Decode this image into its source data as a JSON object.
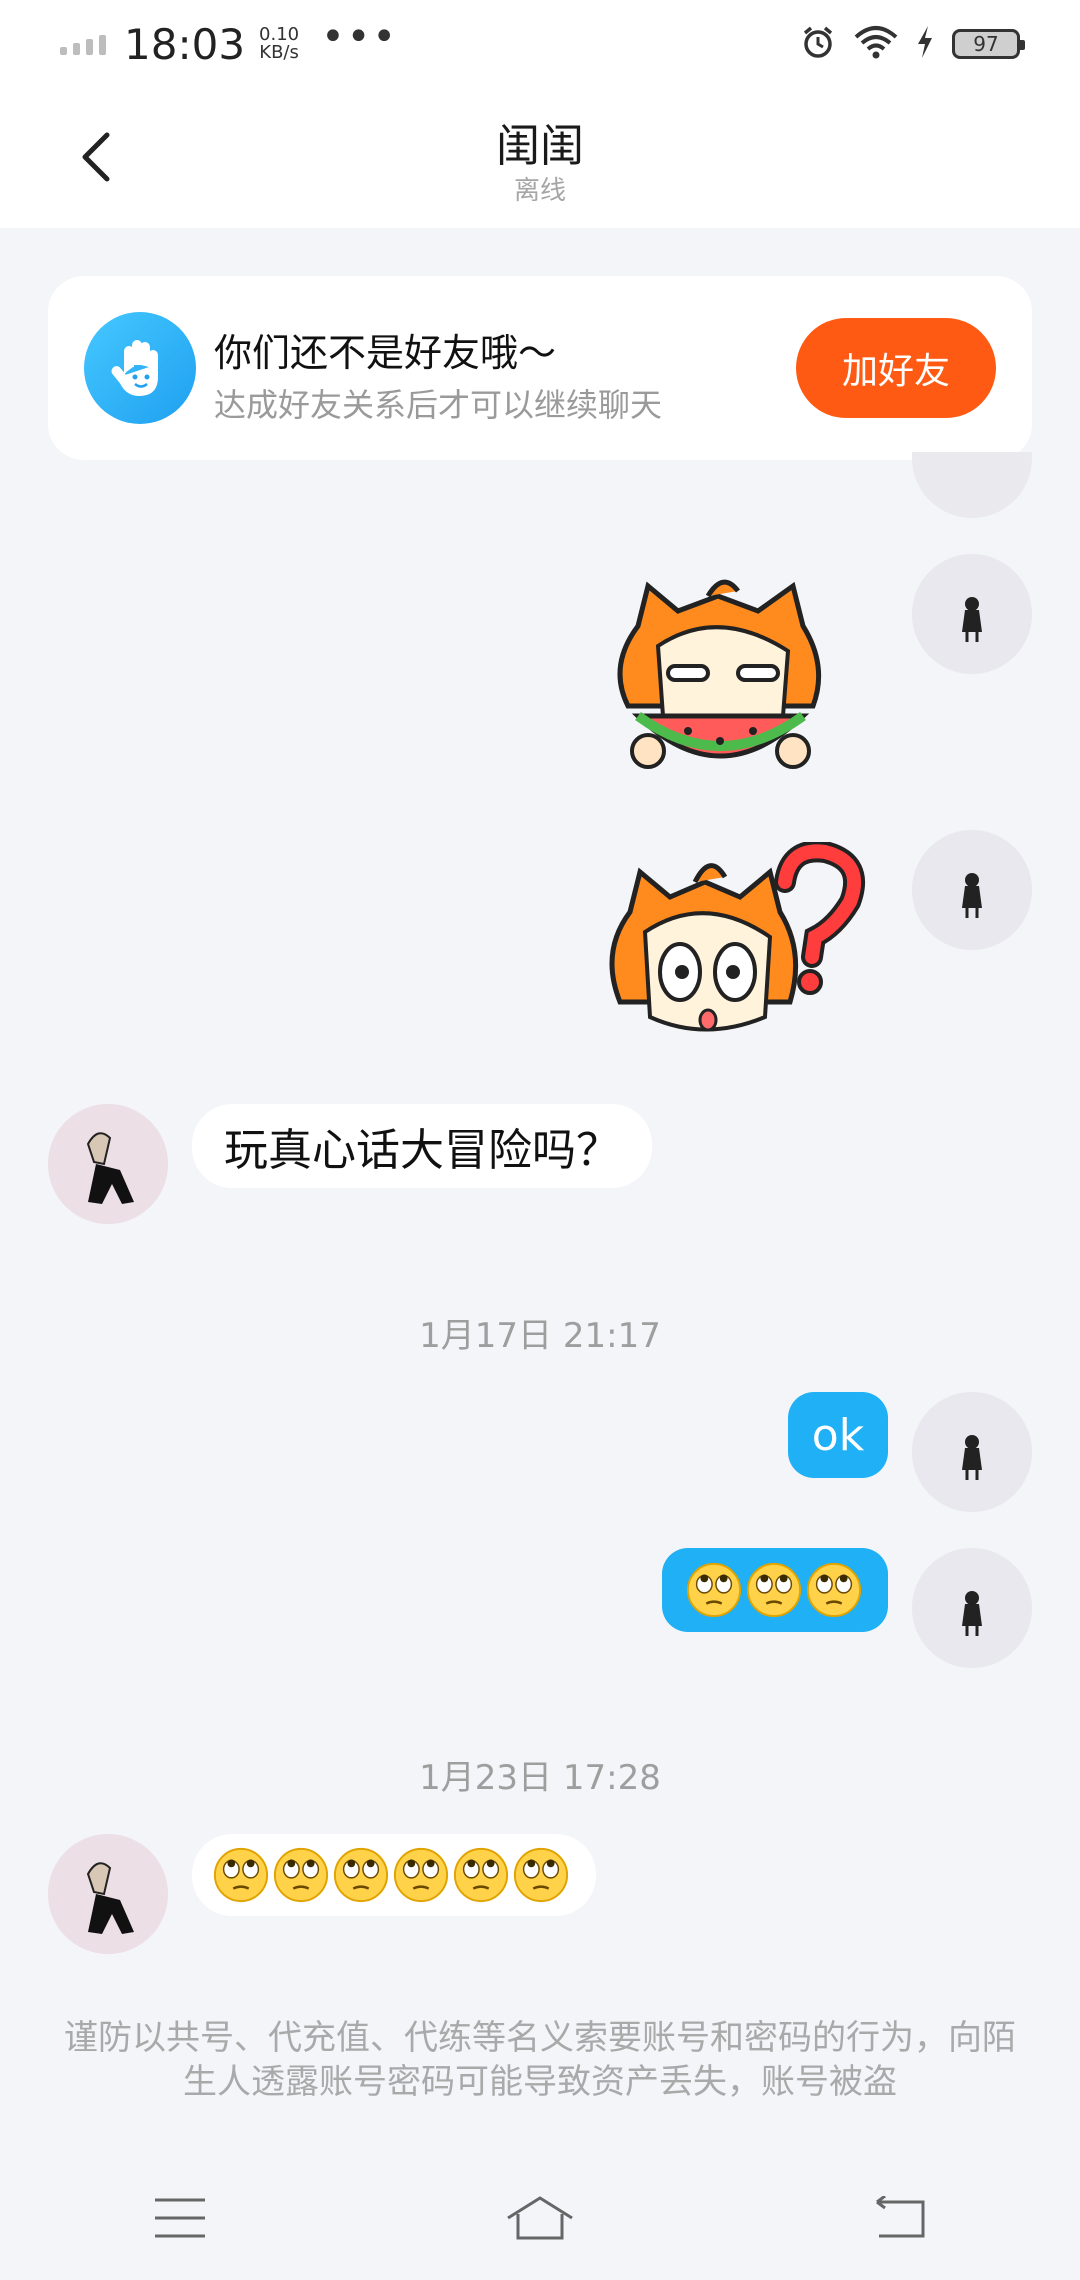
{
  "status_bar": {
    "time": "18:03",
    "net_speed_value": "0.10",
    "net_speed_unit": "KB/s",
    "more": "•••",
    "battery": "97"
  },
  "header": {
    "title": "闺闺",
    "subtitle": "离线"
  },
  "friend_banner": {
    "title": "你们还不是好友哦～",
    "subtitle": "达成好友关系后才可以继续聊天",
    "button": "加好友"
  },
  "messages": {
    "peer_text": "玩真心话大冒险吗？",
    "time_1": "1月17日 21:17",
    "self_ok": "ok",
    "self_eyeroll_count": 3,
    "time_2": "1月23日 17:28",
    "peer_eyeroll_count": 6
  },
  "notice": "谨防以共号、代充值、代练等名义索要账号和密码的行为，向陌生人透露账号密码可能导致资产丢失，账号被盗",
  "icons": {
    "back": "chevron-left-icon",
    "alarm": "alarm-icon",
    "wifi": "wifi-icon",
    "charging": "bolt-icon",
    "hand": "hand-wave-icon",
    "menu": "menu-icon",
    "home": "home-icon",
    "return": "return-icon"
  },
  "colors": {
    "accent_orange": "#ff5a14",
    "bubble_blue": "#1fb0f5",
    "background": "#f3f5f8"
  }
}
